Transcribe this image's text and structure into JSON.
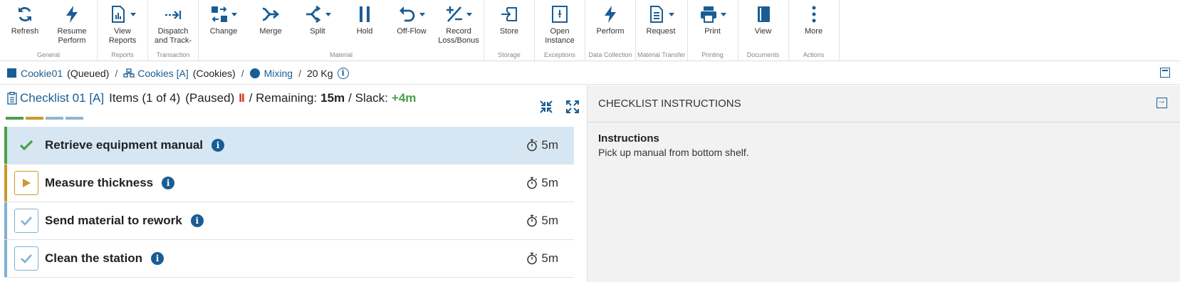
{
  "colors": {
    "accent": "#1a5d95",
    "done": "#4aa04a",
    "in_progress": "#c99a2e",
    "pending": "#7fb0d4",
    "paused": "#d9331f",
    "active_row": "#d6e7f3"
  },
  "ribbon": {
    "groups": [
      {
        "label": "General",
        "buttons": [
          {
            "label": "Refresh",
            "icon": "refresh-icon",
            "caret": false
          },
          {
            "label": "Resume\nPerform",
            "icon": "lightning-icon",
            "caret": false
          }
        ]
      },
      {
        "label": "Reports",
        "buttons": [
          {
            "label": "View\nReports",
            "icon": "report-icon",
            "caret": true
          }
        ]
      },
      {
        "label": "Transaction",
        "buttons": [
          {
            "label": "Dispatch\nand Track-",
            "icon": "dispatch-icon",
            "caret": false
          }
        ]
      },
      {
        "label": "Material",
        "buttons": [
          {
            "label": "Change",
            "icon": "change-icon",
            "caret": true
          },
          {
            "label": "Merge",
            "icon": "merge-icon",
            "caret": false
          },
          {
            "label": "Split",
            "icon": "split-icon",
            "caret": true
          },
          {
            "label": "Hold",
            "icon": "pause-icon",
            "caret": false
          },
          {
            "label": "Off-Flow",
            "icon": "undo-icon",
            "caret": true
          },
          {
            "label": "Record\nLoss/Bonus",
            "icon": "plus-minus-icon",
            "caret": true
          }
        ]
      },
      {
        "label": "Storage",
        "buttons": [
          {
            "label": "Store",
            "icon": "store-icon",
            "caret": false
          }
        ]
      },
      {
        "label": "Exceptions",
        "buttons": [
          {
            "label": "Open\nInstance",
            "icon": "open-instance-icon",
            "caret": false
          }
        ]
      },
      {
        "label": "Data Collection",
        "buttons": [
          {
            "label": "Perform",
            "icon": "lightning-icon",
            "caret": false
          }
        ]
      },
      {
        "label": "Material Transfer",
        "buttons": [
          {
            "label": "Request",
            "icon": "request-icon",
            "caret": true
          }
        ]
      },
      {
        "label": "Printing",
        "buttons": [
          {
            "label": "Print",
            "icon": "printer-icon",
            "caret": true
          }
        ]
      },
      {
        "label": "Documents",
        "buttons": [
          {
            "label": "View",
            "icon": "book-icon",
            "caret": false
          }
        ]
      },
      {
        "label": "Actions",
        "buttons": [
          {
            "label": "More",
            "icon": "more-vertical-icon",
            "caret": false
          }
        ]
      }
    ]
  },
  "breadcrumb": {
    "material_name": "Cookie01",
    "material_state": "(Queued)",
    "product_name": "Cookies [A]",
    "product_desc": "(Cookies)",
    "step_name": "Mixing",
    "quantity": "20 Kg",
    "separator": "/"
  },
  "checklist": {
    "title": "Checklist 01 [A]",
    "items_count": "Items (1 of 4)",
    "state": "(Paused)",
    "paused_glyph": "II",
    "remaining_label": "/ Remaining:",
    "remaining_value": "15m",
    "slack_label": "/ Slack:",
    "slack_value": "+4m",
    "progress_segments": [
      "#4aa04a",
      "#c99a2e",
      "#8fb6d3",
      "#8fb6d3"
    ],
    "items": [
      {
        "name": "Retrieve equipment manual",
        "duration": "5m",
        "status": "done",
        "active": true
      },
      {
        "name": "Measure thickness",
        "duration": "5m",
        "status": "in-progress",
        "active": false
      },
      {
        "name": "Send material to rework",
        "duration": "5m",
        "status": "pending",
        "active": false
      },
      {
        "name": "Clean the station",
        "duration": "5m",
        "status": "pending",
        "active": false
      }
    ]
  },
  "instructions": {
    "header": "CHECKLIST INSTRUCTIONS",
    "heading": "Instructions",
    "text": "Pick up manual from bottom shelf."
  }
}
